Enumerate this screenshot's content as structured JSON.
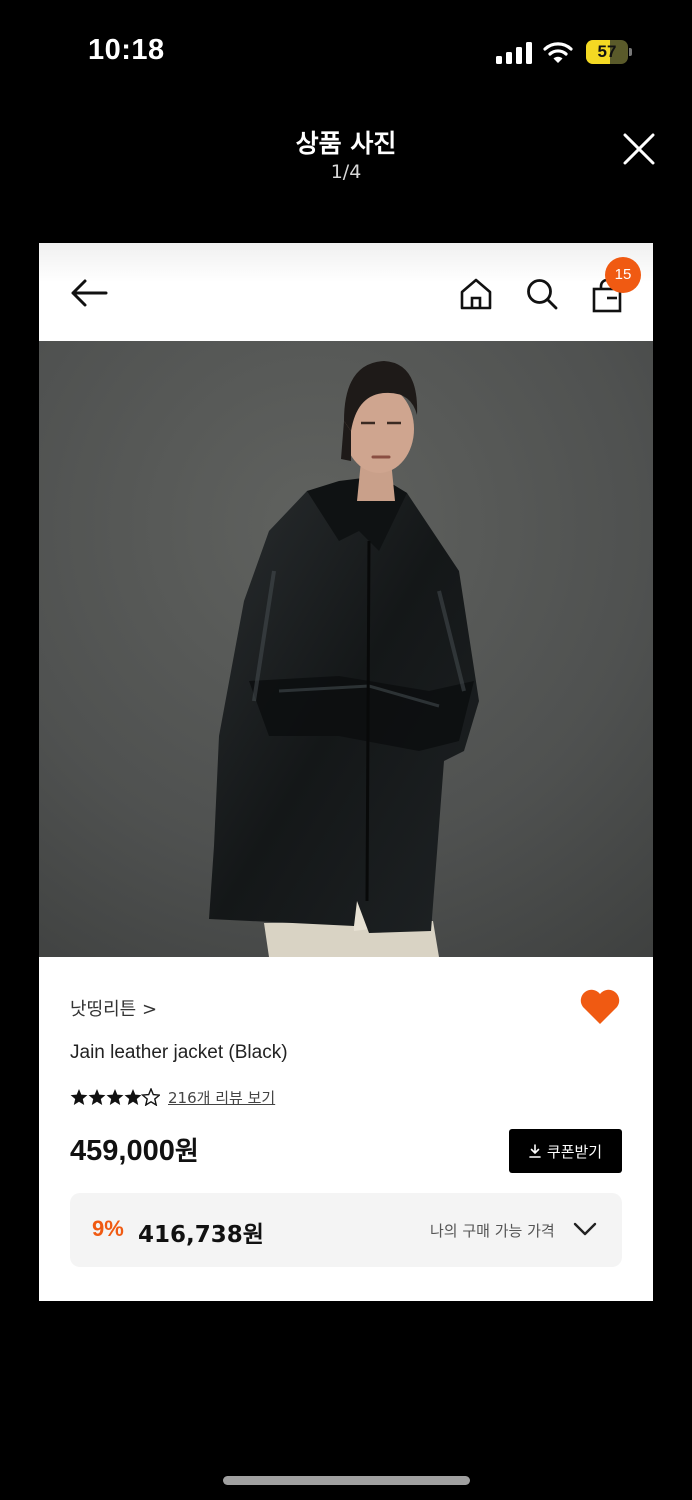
{
  "status_bar": {
    "time": "10:18",
    "battery_percent": "57",
    "battery_level": 0.57
  },
  "viewer": {
    "title": "상품 사진",
    "counter": "1/4"
  },
  "app_header": {
    "cart_count": "15"
  },
  "product": {
    "brand": "낫띵리튼 >",
    "name": "Jain leather jacket (Black)",
    "rating": 4.5,
    "review_link": "216개 리뷰 보기",
    "price_number": "459,000",
    "price_unit": "원",
    "coupon_label": "쿠폰받기",
    "discount": "9%",
    "my_price": "416,738원",
    "my_price_label": "나의 구매 가능 가격",
    "favorited": true
  },
  "colors": {
    "accent": "#f05a12",
    "battery": "#f4d923",
    "card": "#ffffff",
    "backdrop": "#000000"
  }
}
